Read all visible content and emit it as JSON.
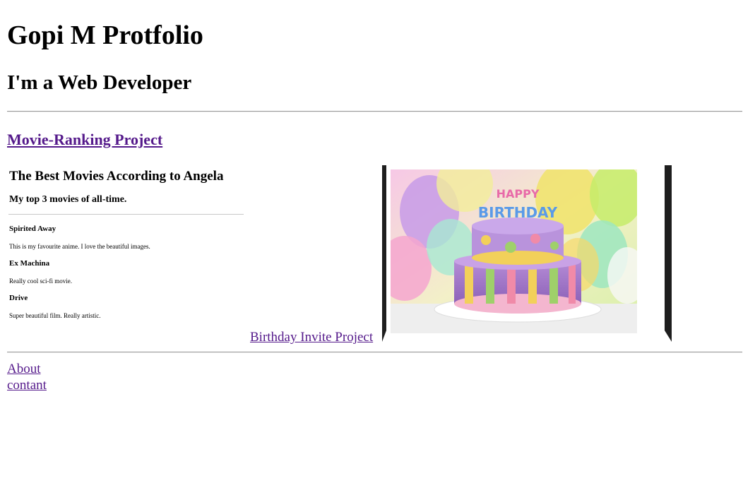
{
  "header": {
    "title": "Gopi M Protfolio",
    "subtitle": "I'm a Web Developer"
  },
  "projects": {
    "movie_link": "Movie-Ranking Project",
    "movie_preview": {
      "title": "The Best Movies According to Angela",
      "subtitle": "My top 3 movies of all-time.",
      "movies": [
        {
          "name": "Spirited Away",
          "desc": "This is my favourite anime. I love the beautiful images."
        },
        {
          "name": "Ex Machina",
          "desc": "Really cool sci-fi movie."
        },
        {
          "name": "Drive",
          "desc": "Super beautiful film. Really artistic."
        }
      ]
    },
    "birthday_link": "Birthday Invite Project",
    "cake_topper_text": "HAPPY BIRTHDAY"
  },
  "footer": {
    "about": "About",
    "contact": "contant"
  },
  "colors": {
    "link": "#551a8b",
    "frame": "#1e1e1e",
    "rule": "#9a9a9a"
  }
}
